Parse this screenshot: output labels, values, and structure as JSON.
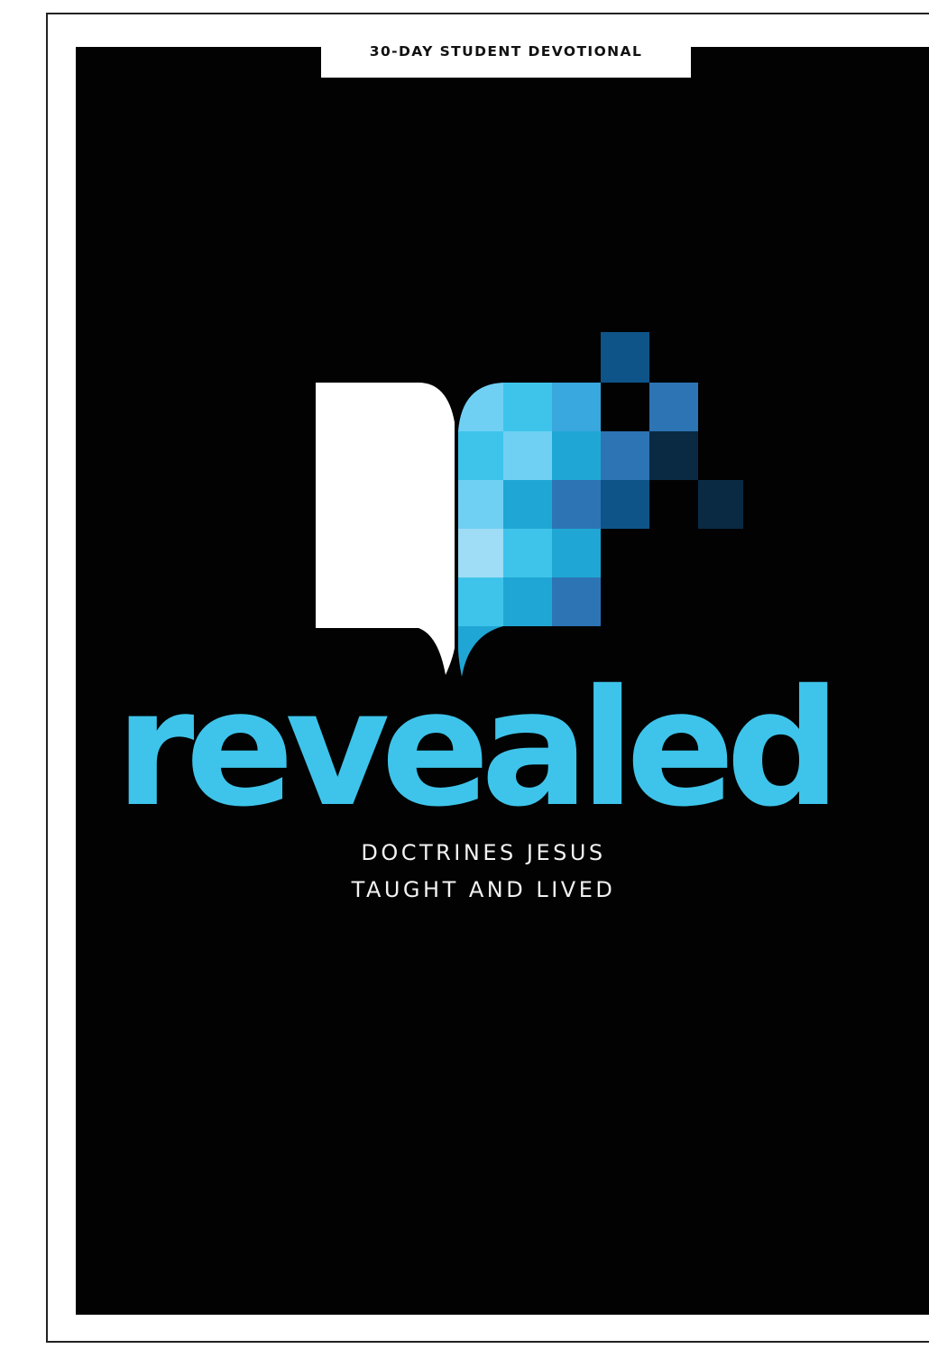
{
  "cover": {
    "series_label": "30-DAY STUDENT DEVOTIONAL",
    "title": "revealed",
    "subtitle_line1": "DOCTRINES JESUS",
    "subtitle_line2": "TAUGHT AND LIVED"
  },
  "logo": {
    "icon": "open-book-pixel-icon",
    "page_color": "#ffffff",
    "pixel_colors": [
      "#7dd3f3",
      "#3ec4ea",
      "#1fa6d4",
      "#2d74b4",
      "#0e5488",
      "#0a2a44"
    ]
  },
  "colors": {
    "cover_background": "#020202",
    "title": "#3ec4ea",
    "subtitle": "#f2f2f2",
    "series_label": "#111111",
    "series_tab": "#ffffff"
  }
}
